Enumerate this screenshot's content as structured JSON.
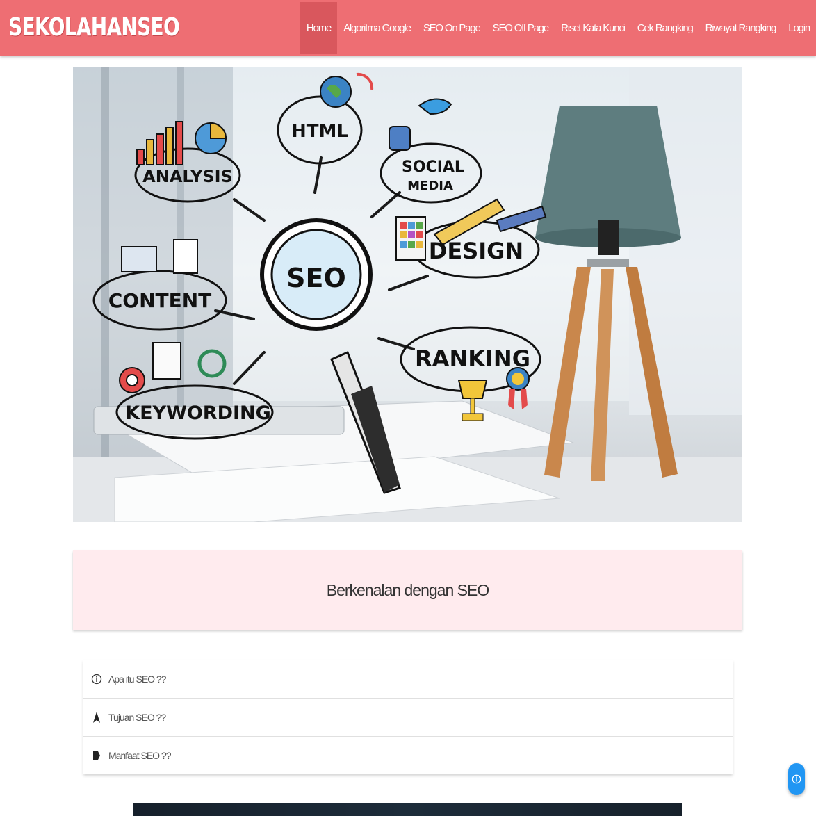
{
  "brand": "SEKOLAHANSEO",
  "nav": {
    "items": [
      {
        "label": "Home",
        "active": true
      },
      {
        "label": "Algoritma Google",
        "active": false
      },
      {
        "label": "SEO On Page",
        "active": false
      },
      {
        "label": "SEO Off Page",
        "active": false
      },
      {
        "label": "Riset Kata Kunci",
        "active": false
      },
      {
        "label": "Cek Rangking",
        "active": false
      },
      {
        "label": "Riwayat Rangking",
        "active": false
      },
      {
        "label": "Login",
        "active": false
      }
    ]
  },
  "hero": {
    "labels": {
      "seo": "SEO",
      "html": "HTML",
      "analysis": "ANALYSIS",
      "social": "SOCIAL",
      "media": "MEDIA",
      "design": "DESIGN",
      "content": "CONTENT",
      "ranking": "RANKING",
      "keywording": "KEYWORDING"
    }
  },
  "section_title": "Berkenalan dengan SEO",
  "collapsible": {
    "items": [
      {
        "icon": "info-icon",
        "label": "Apa itu SEO ??"
      },
      {
        "icon": "navigation-arrow-icon",
        "label": "Tujuan SEO ??"
      },
      {
        "icon": "label-tag-icon",
        "label": "Manfaat SEO ??"
      }
    ]
  },
  "colors": {
    "navbar": "#ee6e73",
    "navbar_active": "#d9575d",
    "title_card_bg": "#ffebee",
    "fab": "#2196f3"
  }
}
